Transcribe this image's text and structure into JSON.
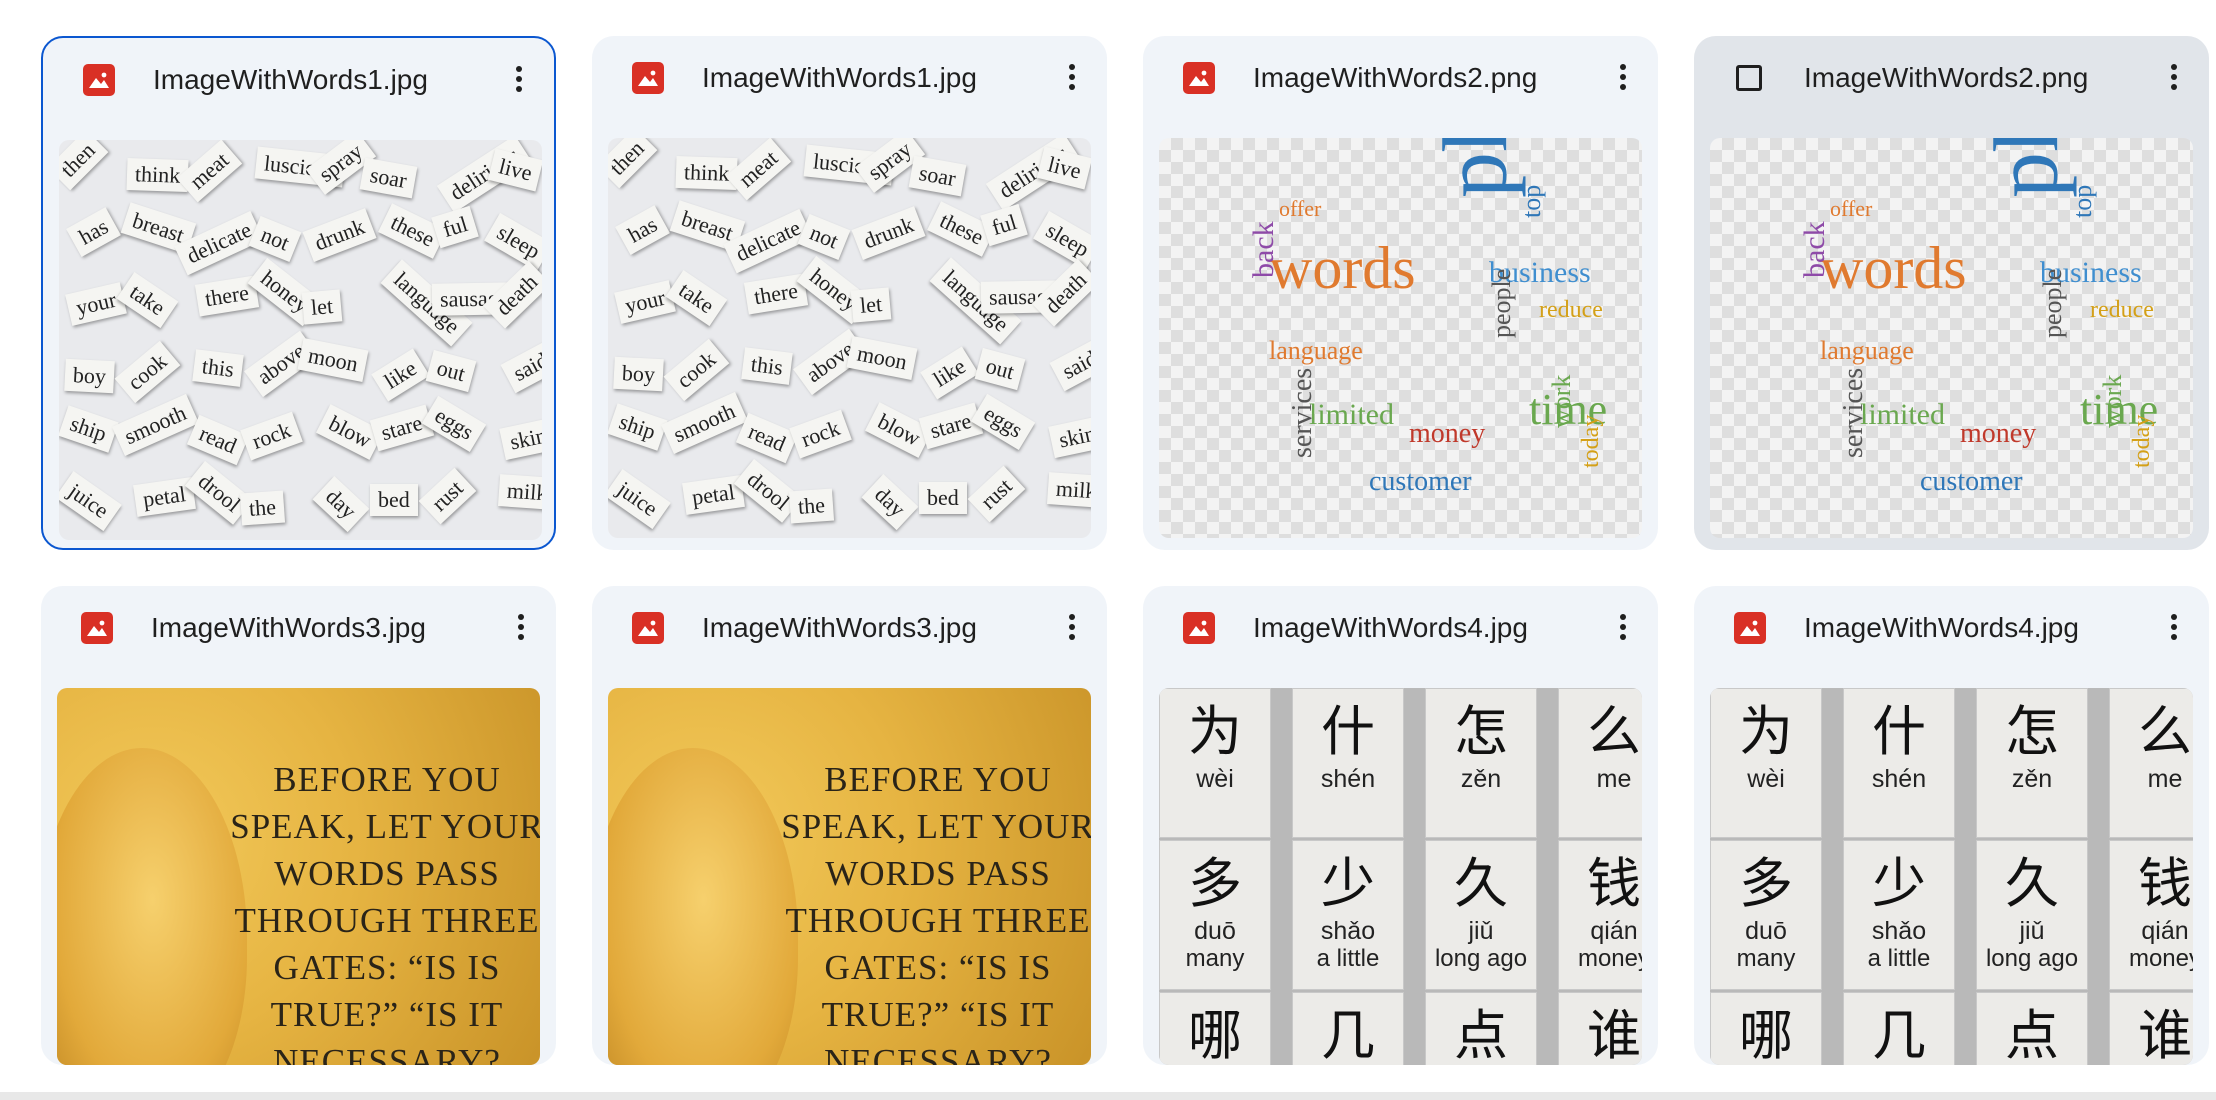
{
  "files": [
    {
      "name": "ImageWithWords1.jpg",
      "kind": "magnets"
    },
    {
      "name": "ImageWithWords1.jpg",
      "kind": "magnets"
    },
    {
      "name": "ImageWithWords2.png",
      "kind": "cloud"
    },
    {
      "name": "ImageWithWords2.png",
      "kind": "cloud"
    },
    {
      "name": "ImageWithWords3.jpg",
      "kind": "quote"
    },
    {
      "name": "ImageWithWords3.jpg",
      "kind": "quote"
    },
    {
      "name": "ImageWithWords4.jpg",
      "kind": "tiles"
    },
    {
      "name": "ImageWithWords4.jpg",
      "kind": "tiles"
    }
  ],
  "magnet_words": [
    "then",
    "think",
    "meat",
    "luscious",
    "spray",
    "soar",
    "delirious",
    "live",
    "has",
    "breast",
    "delicate",
    "not",
    "drunk",
    "these",
    "ful",
    "sleep",
    "your",
    "take",
    "there",
    "honey",
    "let",
    "language",
    "sausage",
    "death",
    "boy",
    "cook",
    "this",
    "above",
    "moon",
    "like",
    "out",
    "said",
    "ship",
    "smooth",
    "read",
    "rock",
    "blow",
    "stare",
    "eggs",
    "skin",
    "juice",
    "petal",
    "drool",
    "the",
    "day",
    "bed",
    "rust",
    "milk"
  ],
  "cloud_words": [
    "words",
    "phrases",
    "time",
    "language",
    "limited",
    "money",
    "customer",
    "business",
    "reduce",
    "people",
    "top",
    "back",
    "offer",
    "services",
    "work",
    "today"
  ],
  "quote_text": "BEFORE YOU SPEAK, LET YOUR WORDS PASS THROUGH THREE GATES: “IS IS TRUE?” “IS IT NECESSARY?",
  "tiles": [
    {
      "hz": "为",
      "py": "wèi",
      "en": ""
    },
    {
      "hz": "什",
      "py": "shén",
      "en": ""
    },
    {
      "hz": "怎",
      "py": "zěn",
      "en": ""
    },
    {
      "hz": "么",
      "py": "me",
      "en": ""
    },
    {
      "hz": "多",
      "py": "duō",
      "en": "many"
    },
    {
      "hz": "少",
      "py": "shǎo",
      "en": "a little"
    },
    {
      "hz": "久",
      "py": "jiǔ",
      "en": "long ago"
    },
    {
      "hz": "钱",
      "py": "qián",
      "en": "money"
    },
    {
      "hz": "哪",
      "py": "",
      "en": ""
    },
    {
      "hz": "几",
      "py": "",
      "en": ""
    },
    {
      "hz": "点",
      "py": "",
      "en": ""
    },
    {
      "hz": "谁",
      "py": "",
      "en": ""
    }
  ],
  "icons": {
    "file_type": "image-file-icon",
    "menu": "more-vert-icon",
    "select": "checkbox-icon"
  },
  "colors": {
    "card_bg": "#f0f4f9",
    "selected_border": "#0b57d0",
    "file_icon": "#d93025",
    "hover_bg": "#e1e5ea"
  }
}
